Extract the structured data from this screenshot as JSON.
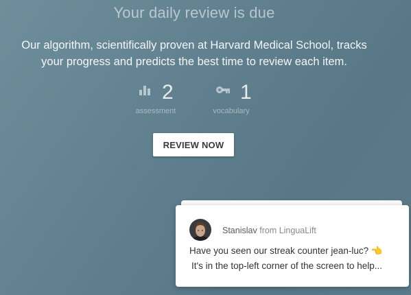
{
  "review": {
    "title": "Your daily review is due",
    "description_line1": "Our algorithm, scientifically proven at Harvard Medical School, tracks",
    "description_line2": "your progress and predicts the best time to review each item.",
    "stats": [
      {
        "icon": "bar-chart-icon",
        "count": "2",
        "label": "assessment"
      },
      {
        "icon": "key-icon",
        "count": "1",
        "label": "vocabulary"
      }
    ],
    "button_label": "REVIEW NOW"
  },
  "chat": {
    "sender_name": "Stanislav",
    "sender_from": "from LinguaLift",
    "message_line1": "Have you seen our streak counter jean-luc? 👈",
    "message_line2": "It's in the top-left corner of the screen to help..."
  }
}
